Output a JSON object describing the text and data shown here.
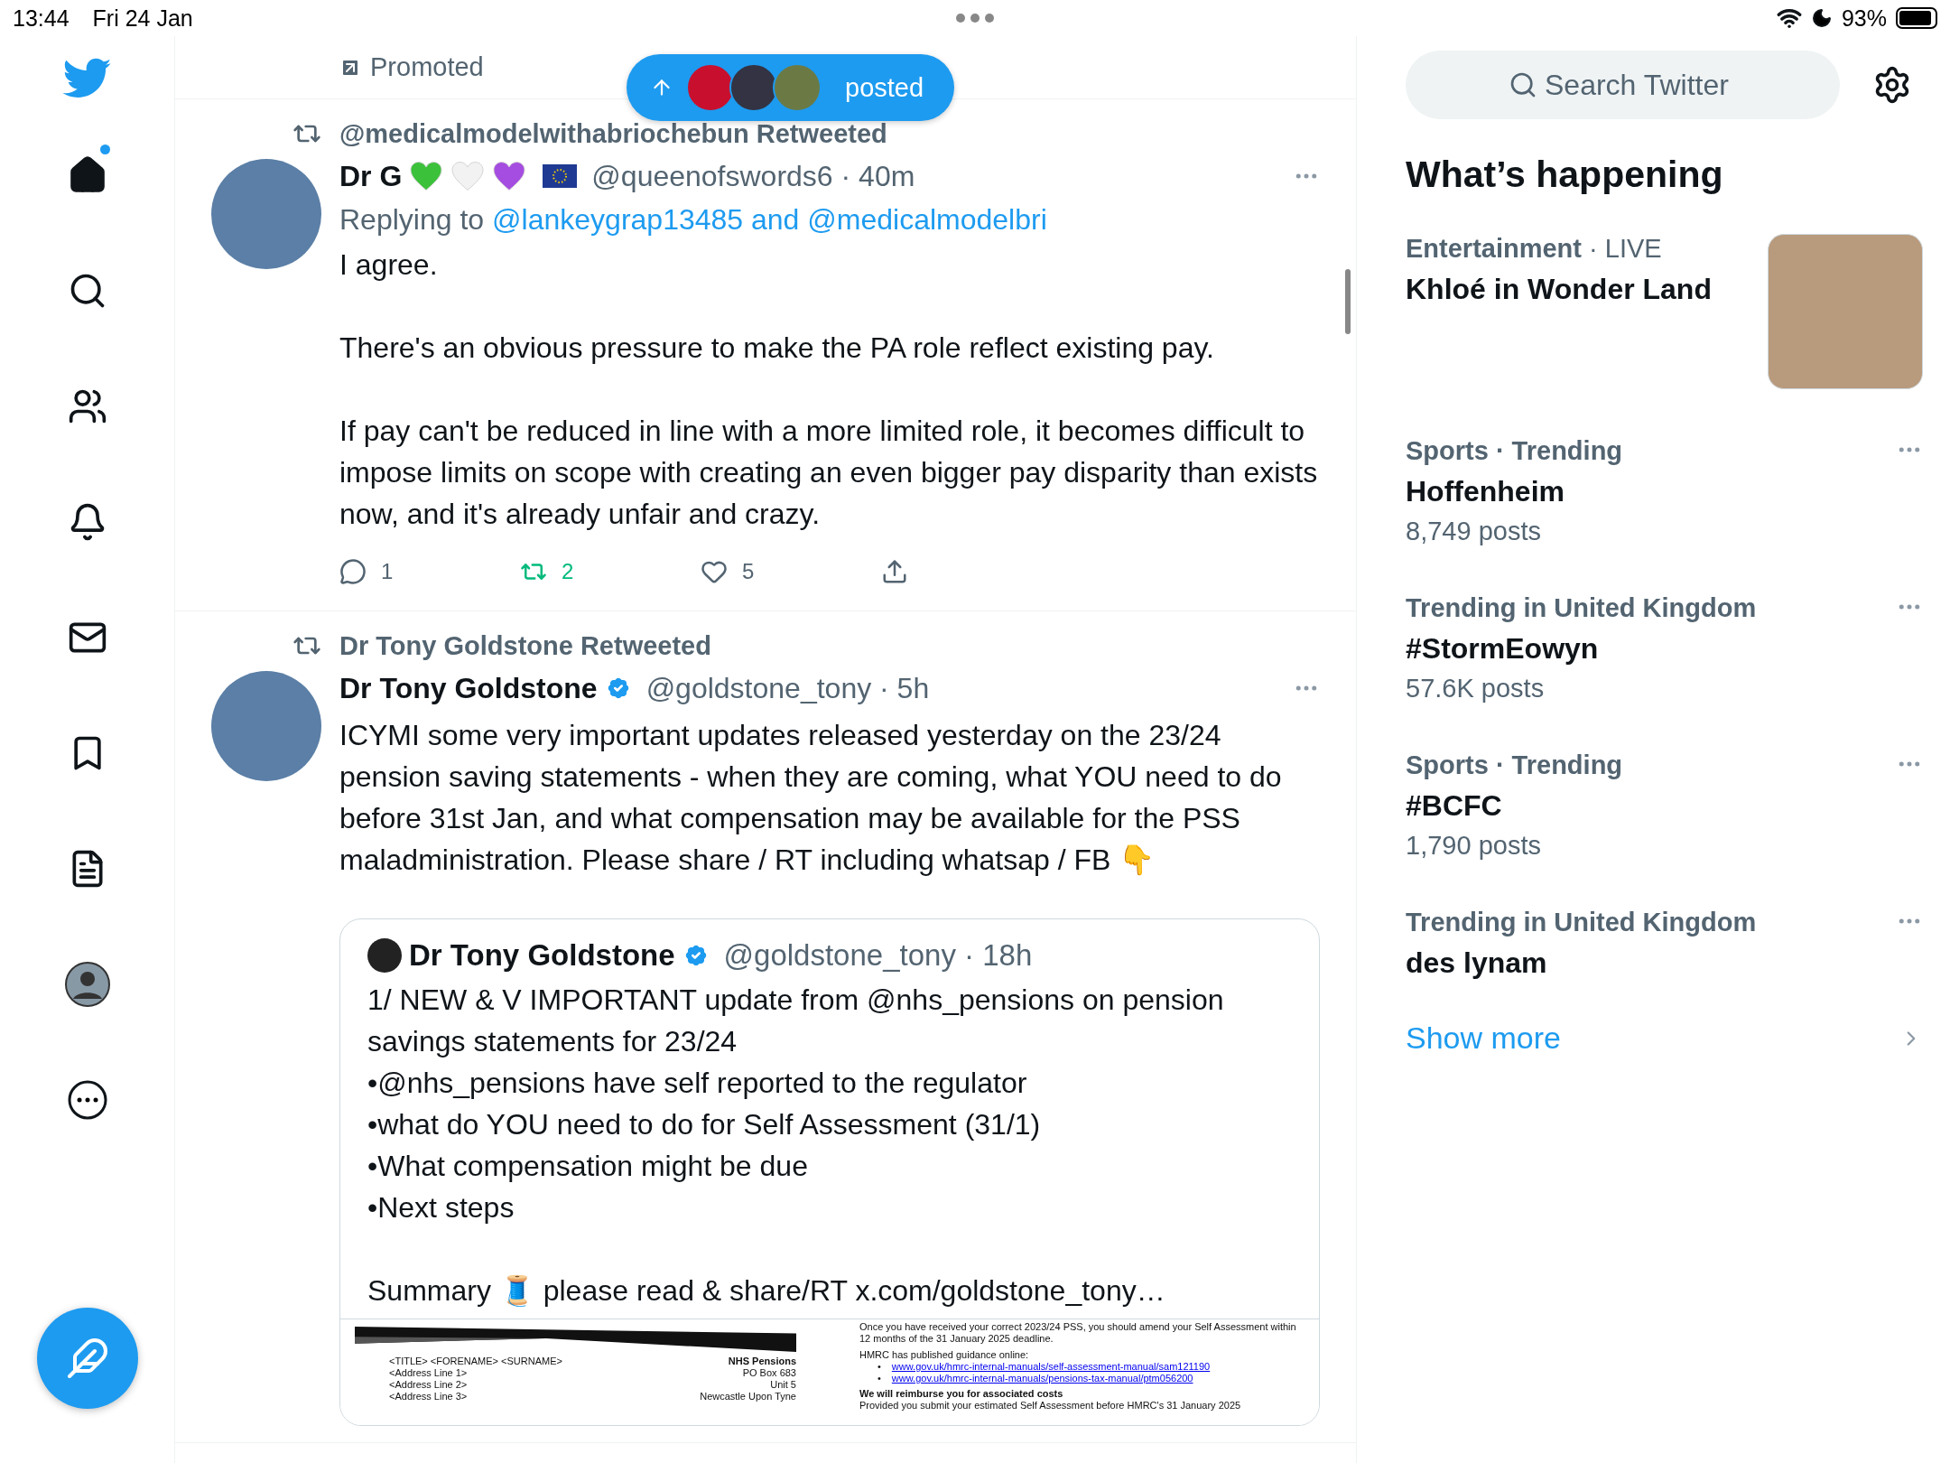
{
  "status_bar": {
    "time": "13:44",
    "date": "Fri 24 Jan",
    "battery": "93%"
  },
  "sidebar": {
    "nav": [
      {
        "kind": "home",
        "selected": true,
        "dot": true
      },
      {
        "kind": "search",
        "selected": false,
        "dot": false
      },
      {
        "kind": "communities",
        "selected": false,
        "dot": false
      },
      {
        "kind": "notifications",
        "selected": false,
        "dot": false
      },
      {
        "kind": "messages",
        "selected": false,
        "dot": false
      },
      {
        "kind": "bookmarks",
        "selected": false,
        "dot": false
      },
      {
        "kind": "lists",
        "selected": false,
        "dot": false
      },
      {
        "kind": "profile",
        "selected": false,
        "dot": false
      },
      {
        "kind": "more",
        "selected": false,
        "dot": false
      }
    ]
  },
  "timeline": {
    "promoted": "Promoted",
    "new_posts_pill": "posted",
    "tweets": [
      {
        "retweeted_by": "@medicalmodelwithabriochebun Retweeted",
        "name": "Dr G",
        "verified": false,
        "badges": [
          {
            "kind": "heart",
            "color": "#3bc13a"
          },
          {
            "kind": "heart",
            "color": "#f2f2f2"
          },
          {
            "kind": "heart",
            "color": "#a54de0"
          },
          {
            "kind": "eu-flag"
          }
        ],
        "meta": "@queenofswords6 · 40m",
        "replying_label": "Replying to",
        "replying_to": "@lankeygrap13485 and @medicalmodelbri",
        "paragraphs": [
          "I agree.",
          "There's an obvious pressure to make the PA role reflect existing pay.",
          "If pay can't be reduced in line with a more limited role, it becomes difficult to impose limits on scope with creating an even bigger pay disparity than exists now, and it's already unfair and crazy."
        ],
        "actions": [
          {
            "kind": "reply",
            "count": "1",
            "active": false
          },
          {
            "kind": "retweet",
            "count": "2",
            "active": true
          },
          {
            "kind": "like",
            "count": "5",
            "active": false
          },
          {
            "kind": "share"
          }
        ]
      },
      {
        "retweeted_by": "Dr Tony Goldstone Retweeted",
        "name": "Dr Tony Goldstone",
        "verified": true,
        "meta": "@goldstone_tony · 5h",
        "paragraphs": [
          "ICYMI some very important updates released yesterday on the 23/24 pension saving statements - when they are coming, what YOU need to do before 31st Jan, and what compensation may be available for the PSS maladministration. Please share / RT including whatsap / FB 👇"
        ],
        "quote": {
          "name": "Dr Tony Goldstone",
          "verified": true,
          "meta": "@goldstone_tony · 18h",
          "lines": [
            "1/ NEW & V IMPORTANT update from @nhs_pensions on pension savings statements for 23/24",
            "•@nhs_pensions have self reported to the regulator",
            "•what do YOU need to do for Self Assessment (31/1)",
            "•What compensation might be due",
            "•Next steps"
          ],
          "summary": "Summary 🧵 please read & share/RT x.com/goldstone_tony…",
          "document": {
            "addressee": [
              "<TITLE> <FORENAME> <SURNAME>",
              "<Address Line 1>",
              "<Address Line 2>",
              "<Address Line 3>"
            ],
            "sender": [
              "NHS Pensions",
              "PO Box 683",
              "Unit 5",
              "Newcastle Upon Tyne"
            ],
            "body_top": "Once you have received your correct 2023/24 PSS, you should amend your Self Assessment within 12 months of the 31 January 2025 deadline.",
            "guidance": "HMRC has published guidance online:",
            "links": [
              {
                "bullet": "•",
                "url": "www.gov.uk/hmrc-internal-manuals/self-assessment-manual/sam121190"
              },
              {
                "bullet": "•",
                "url": "www.gov.uk/hmrc-internal-manuals/pensions-tax-manual/ptm056200"
              }
            ],
            "heading": "We will reimburse you for associated costs",
            "body_bottom": "Provided you submit your estimated Self Assessment before HMRC's 31 January 2025"
          }
        }
      }
    ]
  },
  "right": {
    "search_placeholder": "Search Twitter",
    "heading": "What’s happening",
    "trends": [
      {
        "category": "Entertainment",
        "context": "· LIVE",
        "title": "Khloé in Wonder Land",
        "has_image": true
      },
      {
        "category": "Sports · Trending",
        "title": "Hoffenheim",
        "posts": "8,749 posts",
        "has_image": false
      },
      {
        "category": "Trending in United Kingdom",
        "title": "#StormEowyn",
        "posts": "57.6K posts",
        "has_image": false
      },
      {
        "category": "Sports · Trending",
        "title": "#BCFC",
        "posts": "1,790 posts",
        "has_image": false
      },
      {
        "category": "Trending in United Kingdom",
        "title": "des lynam",
        "has_image": false
      }
    ],
    "show_more": "Show more"
  }
}
